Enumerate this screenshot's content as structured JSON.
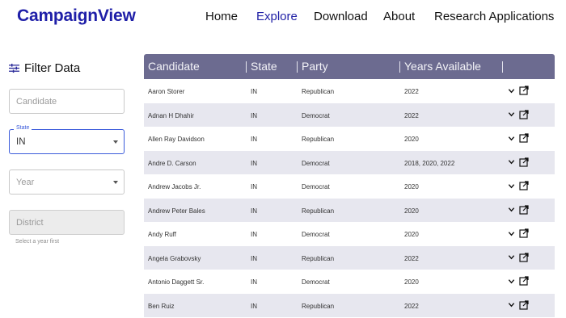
{
  "header": {
    "brand": "CampaignView",
    "nav": [
      "Home",
      "Explore",
      "Download",
      "About",
      "Research Applications"
    ],
    "active_nav": "Explore"
  },
  "filter": {
    "title": "Filter Data",
    "candidate_placeholder": "Candidate",
    "state_label": "State",
    "state_value": "IN",
    "year_placeholder": "Year",
    "district_placeholder": "District",
    "district_helper": "Select a year first"
  },
  "table": {
    "columns": [
      "Candidate",
      "State",
      "Party",
      "Years Available"
    ],
    "rows": [
      {
        "candidate": "Aaron Storer",
        "state": "IN",
        "party": "Republican",
        "years": "2022"
      },
      {
        "candidate": "Adnan H Dhahir",
        "state": "IN",
        "party": "Democrat",
        "years": "2022"
      },
      {
        "candidate": "Allen Ray Davidson",
        "state": "IN",
        "party": "Republican",
        "years": "2020"
      },
      {
        "candidate": "Andre D. Carson",
        "state": "IN",
        "party": "Democrat",
        "years": "2018, 2020, 2022"
      },
      {
        "candidate": "Andrew Jacobs Jr.",
        "state": "IN",
        "party": "Democrat",
        "years": "2020"
      },
      {
        "candidate": "Andrew Peter Bales",
        "state": "IN",
        "party": "Republican",
        "years": "2020"
      },
      {
        "candidate": "Andy Ruff",
        "state": "IN",
        "party": "Democrat",
        "years": "2020"
      },
      {
        "candidate": "Angela Grabovsky",
        "state": "IN",
        "party": "Republican",
        "years": "2022"
      },
      {
        "candidate": "Antonio Daggett Sr.",
        "state": "IN",
        "party": "Democrat",
        "years": "2020"
      },
      {
        "candidate": "Ben Ruiz",
        "state": "IN",
        "party": "Republican",
        "years": "2022"
      }
    ]
  },
  "icons": {
    "expand": "chevron-down-icon",
    "open": "open-external-icon",
    "filter": "sliders-icon"
  },
  "colors": {
    "brand": "#1f1fa8",
    "active_nav": "#2020a6",
    "table_header": "#6c6b90",
    "row_alt": "#e7e7ef",
    "focus": "#3b5bdb"
  }
}
